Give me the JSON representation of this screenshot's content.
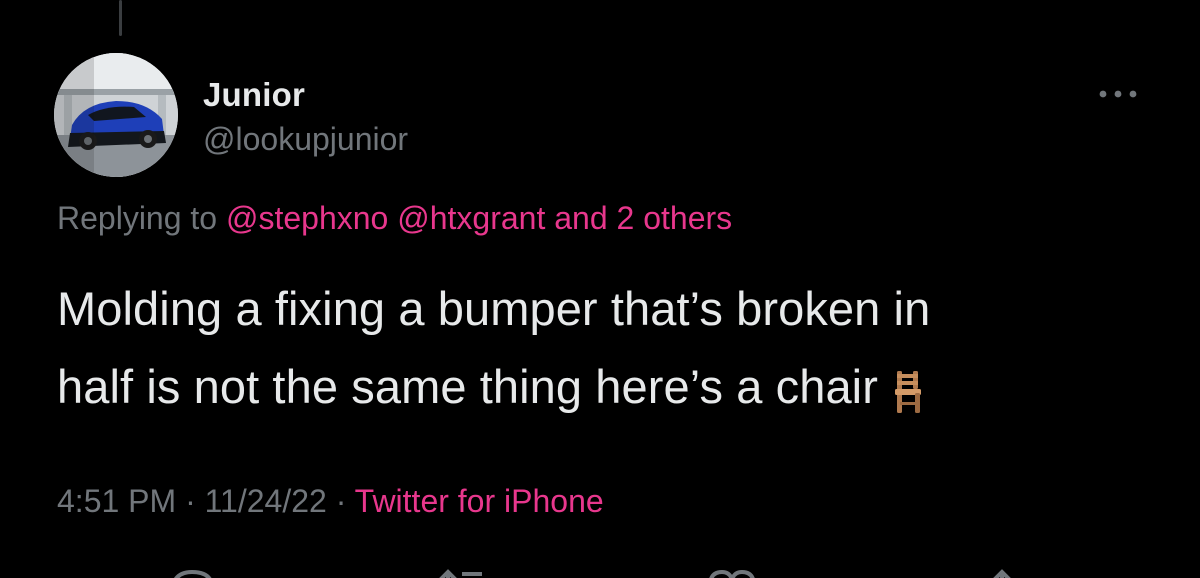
{
  "tweet": {
    "author_name": "Junior",
    "author_handle": "@lookupjunior",
    "replying_prefix": "Replying to ",
    "mentions": [
      "@stephxno",
      "@htxgrant"
    ],
    "mention_suffix": "and 2 others",
    "text_line1": "Molding a fixing a bumper that’s broken in",
    "text_line2": "half is not the same thing here’s a chair",
    "time": "4:51 PM",
    "date": "11/24/22",
    "separator": " · ",
    "source": "Twitter for iPhone"
  },
  "icons": {
    "more": "more-icon",
    "chair": "chair-icon",
    "reply": "reply-icon",
    "retweet": "retweet-icon",
    "like": "like-icon",
    "share": "share-icon"
  },
  "colors": {
    "background": "#000000",
    "text": "#e7e9ea",
    "secondary": "#71767b",
    "accent": "#e8378d"
  }
}
